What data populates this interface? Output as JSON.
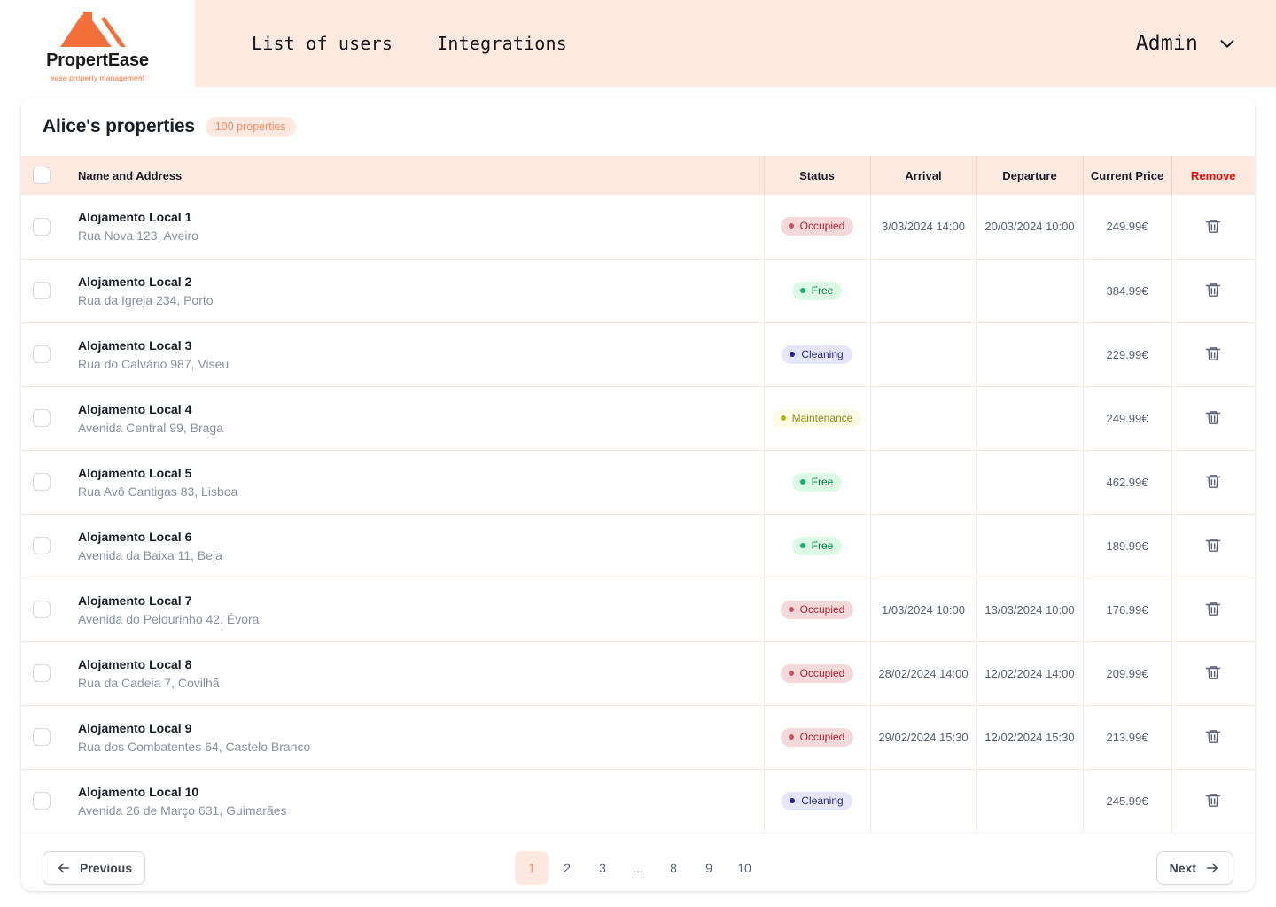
{
  "brand": {
    "name": "PropertEase",
    "tagline": "ease property management",
    "logo_icon": "house-roof-icon"
  },
  "nav": {
    "links": [
      {
        "label": "List of users"
      },
      {
        "label": "Integrations"
      }
    ],
    "account": {
      "label": "Admin",
      "chevron_icon": "chevron-down-icon"
    }
  },
  "card": {
    "title": "Alice's properties",
    "count_badge": "100 properties"
  },
  "table": {
    "headers": {
      "name": "Name and Address",
      "status": "Status",
      "arrival": "Arrival",
      "departure": "Departure",
      "price": "Current Price",
      "remove": "Remove"
    },
    "select_all_checkbox": "unchecked",
    "row_checkbox_state": "unchecked",
    "delete_icon": "trash-icon",
    "rows": [
      {
        "name": "Alojamento Local 1",
        "address": "Rua Nova 123, Aveiro",
        "status": "Occupied",
        "status_key": "occupied",
        "arrival": "3/03/2024 14:00",
        "departure": "20/03/2024 10:00",
        "price": "249.99€"
      },
      {
        "name": "Alojamento Local 2",
        "address": "Rua da Igreja 234, Porto",
        "status": "Free",
        "status_key": "free",
        "arrival": "",
        "departure": "",
        "price": "384.99€"
      },
      {
        "name": "Alojamento Local 3",
        "address": "Rua do Calvário 987, Viseu",
        "status": "Cleaning",
        "status_key": "cleaning",
        "arrival": "",
        "departure": "",
        "price": "229.99€"
      },
      {
        "name": "Alojamento Local 4",
        "address": "Avenida Central 99, Braga",
        "status": "Maintenance",
        "status_key": "maintenance",
        "arrival": "",
        "departure": "",
        "price": "249.99€"
      },
      {
        "name": "Alojamento Local 5",
        "address": "Rua Avô Cantigas 83, Lisboa",
        "status": "Free",
        "status_key": "free",
        "arrival": "",
        "departure": "",
        "price": "462.99€"
      },
      {
        "name": "Alojamento Local 6",
        "address": "Avenida da Baixa 11, Beja",
        "status": "Free",
        "status_key": "free",
        "arrival": "",
        "departure": "",
        "price": "189.99€"
      },
      {
        "name": "Alojamento Local 7",
        "address": "Avenida do Pelourinho 42, Évora",
        "status": "Occupied",
        "status_key": "occupied",
        "arrival": "1/03/2024 10:00",
        "departure": "13/03/2024 10:00",
        "price": "176.99€"
      },
      {
        "name": "Alojamento Local 8",
        "address": "Rua da Cadeia 7, Covilhã",
        "status": "Occupied",
        "status_key": "occupied",
        "arrival": "28/02/2024 14:00",
        "departure": "12/02/2024 14:00",
        "price": "209.99€"
      },
      {
        "name": "Alojamento Local 9",
        "address": "Rua dos Combatentes 64, Castelo Branco",
        "status": "Occupied",
        "status_key": "occupied",
        "arrival": "29/02/2024 15:30",
        "departure": "12/02/2024 15:30",
        "price": "213.99€"
      },
      {
        "name": "Alojamento Local 10",
        "address": "Avenida 26 de Março 631, Guimarães",
        "status": "Cleaning",
        "status_key": "cleaning",
        "arrival": "",
        "departure": "",
        "price": "245.99€"
      }
    ]
  },
  "pagination": {
    "previous_label": "Previous",
    "next_label": "Next",
    "previous_icon": "arrow-left-icon",
    "next_icon": "arrow-right-icon",
    "current_page": "1",
    "pages": [
      "1",
      "2",
      "3",
      "...",
      "8",
      "9",
      "10"
    ]
  },
  "colors": {
    "brand_orange": "#f4703a",
    "nav_background": "#fde9df",
    "remove_red": "#ef0404",
    "accent_peach": "#fde9df",
    "status_occupied": "#b4232f",
    "status_free": "#0a7a45",
    "status_cleaning": "#2b2b8f",
    "status_maintenance": "#8a8a17"
  }
}
